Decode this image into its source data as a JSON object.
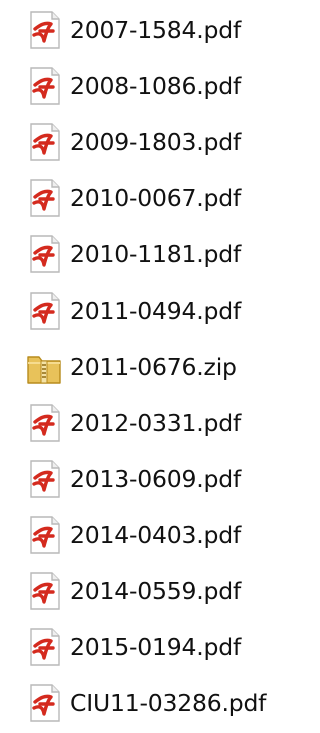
{
  "files": [
    {
      "name": "2007-1584.pdf",
      "icon": "pdf-file-icon"
    },
    {
      "name": "2008-1086.pdf",
      "icon": "pdf-file-icon"
    },
    {
      "name": "2009-1803.pdf",
      "icon": "pdf-file-icon"
    },
    {
      "name": "2010-0067.pdf",
      "icon": "pdf-file-icon"
    },
    {
      "name": "2010-1181.pdf",
      "icon": "pdf-file-icon"
    },
    {
      "name": "2011-0494.pdf",
      "icon": "pdf-file-icon"
    },
    {
      "name": "2011-0676.zip",
      "icon": "zip-folder-icon"
    },
    {
      "name": "2012-0331.pdf",
      "icon": "pdf-file-icon"
    },
    {
      "name": "2013-0609.pdf",
      "icon": "pdf-file-icon"
    },
    {
      "name": "2014-0403.pdf",
      "icon": "pdf-file-icon"
    },
    {
      "name": "2014-0559.pdf",
      "icon": "pdf-file-icon"
    },
    {
      "name": "2015-0194.pdf",
      "icon": "pdf-file-icon"
    },
    {
      "name": "CIU11-03286.pdf",
      "icon": "pdf-file-icon"
    }
  ],
  "colors": {
    "pdf_accent": "#d42a1e",
    "zip_folder": "#e8c25a",
    "text": "#111111"
  }
}
